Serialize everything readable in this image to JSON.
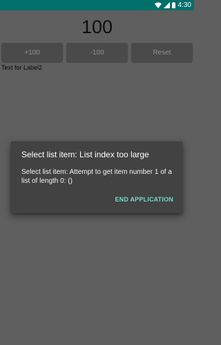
{
  "status_bar": {
    "time": "4:30",
    "background": "#00706a",
    "icons": [
      "wifi-icon",
      "signal-icon",
      "battery-icon"
    ]
  },
  "counter": {
    "value": "100"
  },
  "buttons": {
    "plus_label": "+100",
    "minus_label": "-100",
    "reset_label": "Reset"
  },
  "label2": {
    "text": "Text for Label2"
  },
  "dialog": {
    "title": "Select list item: List index too large",
    "message": "Select list item: Attempt to get item number 1 of a list of length 0: ()",
    "action_label": "END APPLICATION",
    "action_color": "#76d6c6"
  }
}
